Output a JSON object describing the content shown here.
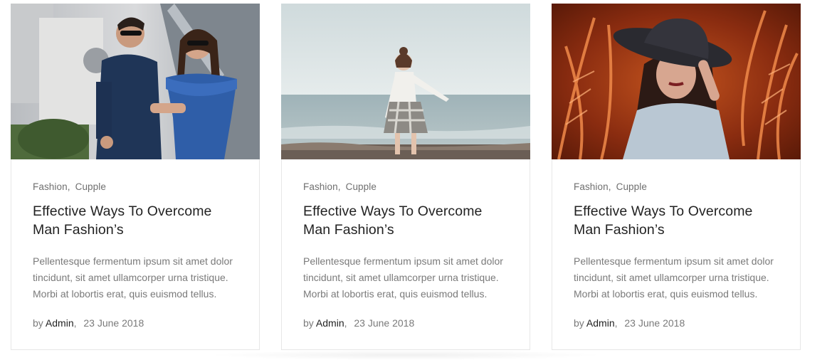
{
  "posts": [
    {
      "categories": [
        "Fashion",
        "Cupple"
      ],
      "title": "Effective Ways To Overcome Man Fashion’s",
      "excerpt": "Pellentesque fermentum ipsum sit amet dolor tincidunt, sit amet ullamcorper urna tristique. Morbi at lobortis erat, quis euismod tellus.",
      "by": "by",
      "author": "Admin",
      "date": "23 June 2018",
      "image": "couple-photo"
    },
    {
      "categories": [
        "Fashion",
        "Cupple"
      ],
      "title": "Effective Ways To Overcome Man Fashion’s",
      "excerpt": "Pellentesque fermentum ipsum sit amet dolor tincidunt, sit amet ullamcorper urna tristique. Morbi at lobortis erat, quis euismod tellus.",
      "by": "by",
      "author": "Admin",
      "date": "23 June 2018",
      "image": "beach-girl-photo"
    },
    {
      "categories": [
        "Fashion",
        "Cupple"
      ],
      "title": "Effective Ways To Overcome Man Fashion’s",
      "excerpt": "Pellentesque fermentum ipsum sit amet dolor tincidunt, sit amet ullamcorper urna tristique. Morbi at lobortis erat, quis euismod tellus.",
      "by": "by",
      "author": "Admin",
      "date": "23 June 2018",
      "image": "woman-hat-photo"
    }
  ],
  "colors": {
    "title": "#222222",
    "text": "#7a7a7a",
    "border": "#e7e7e7"
  }
}
